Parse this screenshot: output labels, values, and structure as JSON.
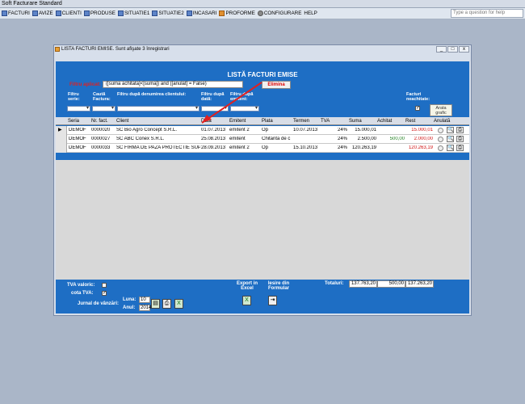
{
  "app": {
    "title": "Soft Facturare Standard"
  },
  "titlebar": {
    "min": "_",
    "max": "□",
    "close": "x"
  },
  "menu": {
    "items": [
      {
        "label": "FACTURI"
      },
      {
        "label": "AVIZE"
      },
      {
        "label": "CLIENTI"
      },
      {
        "label": "PRODUSE"
      },
      {
        "label": "SITUATIE1"
      },
      {
        "label": "SITUATIE2"
      },
      {
        "label": "INCASARI"
      },
      {
        "label": "PROFORME"
      },
      {
        "label": "CONFIGURARE"
      },
      {
        "label": "HELP"
      }
    ],
    "help_placeholder": "Type a question for help"
  },
  "window": {
    "title": "LISTA FACTURI EMISE. Sunt afişate 3 înregistrari"
  },
  "form": {
    "title": "LISTĂ FACTURI EMISE",
    "filter_label": "Filtru aplicat:",
    "filter_value": "([suma achitata]<[suma]) and ([anulat] = False)",
    "remove_filter": "Elimina",
    "filters": {
      "series": "Filtru serie:",
      "search": "Caută Factura:",
      "client": "Filtru după denumirea clientului:",
      "date": "Filtru după dată:",
      "issuer": "Filtru după emitent:",
      "unpaid": "Facturi neachitate:",
      "chart": "Arata grafic"
    },
    "unpaid_checked": "✓"
  },
  "grid": {
    "columns": [
      "Seria",
      "Nr. fact.",
      "Client",
      "Data",
      "Emitent",
      "Plata",
      "Termen",
      "TVA",
      "Suma",
      "Achitat",
      "Rest",
      "Anulată"
    ],
    "rows": [
      {
        "seria": "DEMOF",
        "nr": "0000020",
        "client": "SC Bio Agro Concept S.R.L.",
        "data": "01.07.2013",
        "emitent": "emitent 2",
        "plata": "Op",
        "termen": "10.07.2013",
        "tva": "24%",
        "suma": "15.000,01",
        "achitat": "",
        "rest": "15.000,01"
      },
      {
        "seria": "DEMOF",
        "nr": "0000027",
        "client": "SC ABC Conex S.R.L.",
        "data": "25.08.2013",
        "emitent": "emitent",
        "plata": "Chitanta de c",
        "termen": "",
        "tva": "24%",
        "suma": "2.500,00",
        "achitat": "500,00",
        "rest": "2.000,00"
      },
      {
        "seria": "DEMOF",
        "nr": "0000033",
        "client": "SC FIRMA DE PAZA PROTECTIE SUPR",
        "data": "28.09.2013",
        "emitent": "emitent 2",
        "plata": "Op",
        "termen": "15.10.2013",
        "tva": "24%",
        "suma": "120.263,19",
        "achitat": "",
        "rest": "120.263,19"
      }
    ]
  },
  "bottom": {
    "tva_label": "TVA valoric:",
    "cota_label": "cota TVA:",
    "cota_checked": "✓",
    "journal_label": "Jurnal de vânzări:",
    "month_label": "Luna:",
    "month": "10",
    "year_label": "Anul:",
    "year": "2014",
    "export_label": "Export in Excel",
    "exit_label": "Iesire din Formular",
    "totals_label": "Totaluri:",
    "total_suma": "137.763,20",
    "total_achitat": "500,00",
    "total_rest": "137.263,20"
  }
}
